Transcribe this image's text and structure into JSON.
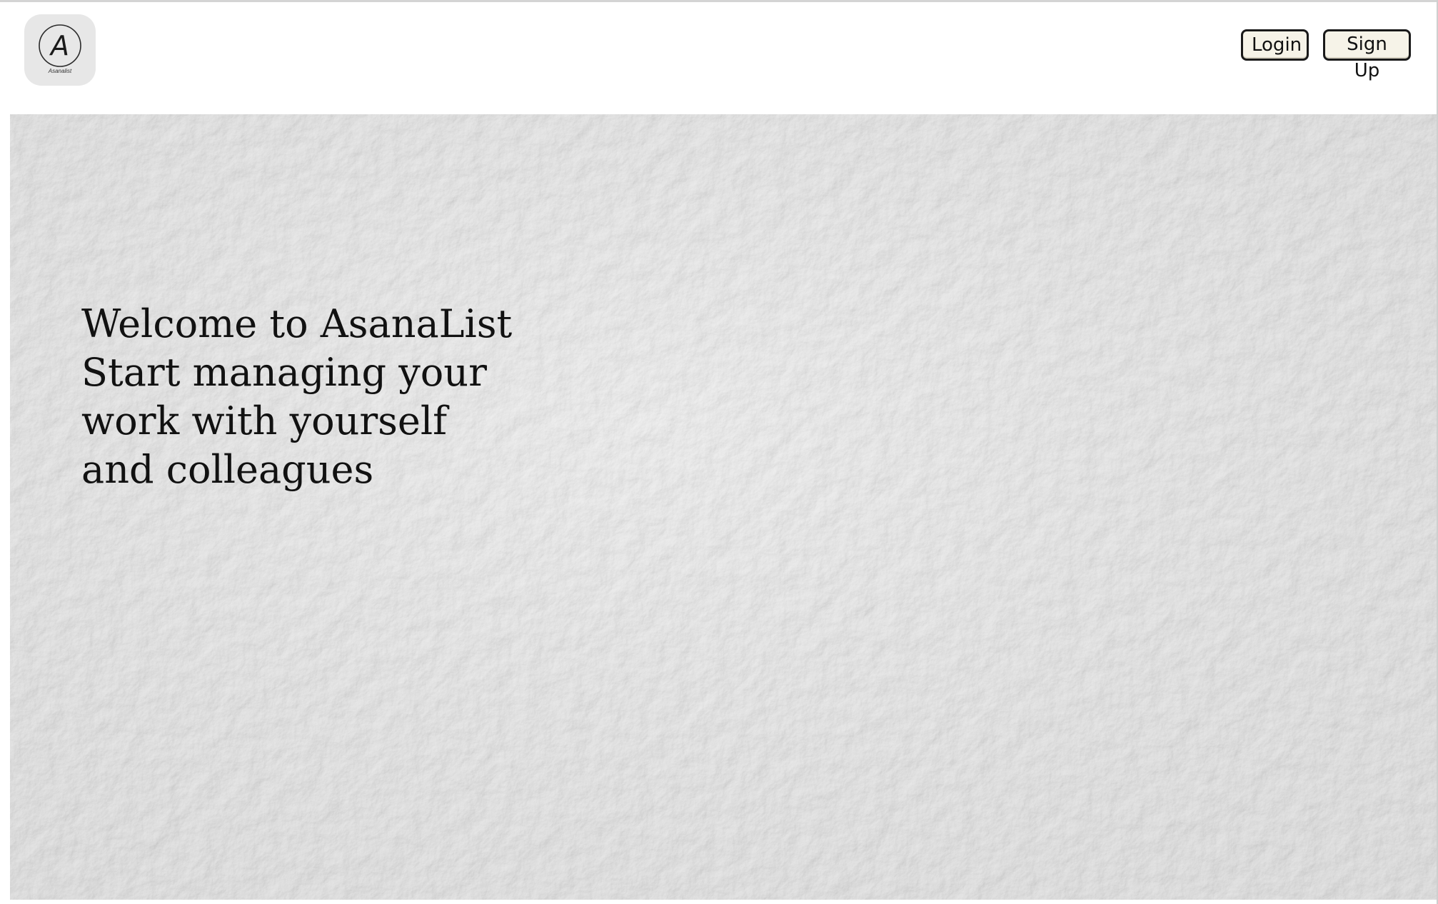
{
  "header": {
    "logo": {
      "letter": "A",
      "wordmark": "Asanalist",
      "icon": "logo-a-icon"
    },
    "buttons": {
      "login_label": "Login",
      "signup_label": "Sign Up"
    }
  },
  "hero": {
    "lines": [
      "Welcome to AsanaList",
      "Start managing your",
      "work with yourself",
      "and colleagues"
    ],
    "background": "white-plaster-texture"
  },
  "colors": {
    "page_background": "#ffffff",
    "logo_background": "#e7e7e7",
    "button_background": "#f6f3e8",
    "button_border": "#1a1a1a",
    "hero_background": "#dadada",
    "text": "#111111"
  }
}
